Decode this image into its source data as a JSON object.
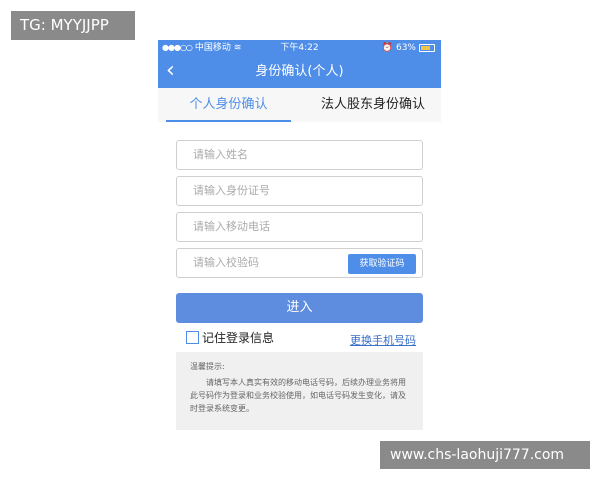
{
  "watermark_top": "TG: MYYJJPP",
  "watermark_bottom": "www.chs-laohuji777.com",
  "status_bar": {
    "carrier": "中国移动",
    "time": "下午4:22",
    "battery": "63%",
    "battery_level": 0.63
  },
  "navbar": {
    "title": "身份确认(个人)"
  },
  "tabs": [
    {
      "label": "个人身份确认",
      "active": true
    },
    {
      "label": "法人股东身份确认",
      "active": false
    }
  ],
  "form": {
    "name_placeholder": "请输入姓名",
    "id_placeholder": "请输入身份证号",
    "phone_placeholder": "请输入移动电话",
    "code_placeholder": "请输入校验码",
    "get_code_label": "获取验证码",
    "submit_label": "进入",
    "remember_label": "记住登录信息",
    "change_phone_label": "更换手机号码"
  },
  "notice": {
    "title": "温馨提示:",
    "body": "请填写本人真实有效的移动电话号码，后续办理业务将用此号码作为登录和业务校验使用，如电话号码发生变化，请及时登录系统变更。"
  },
  "colors": {
    "primary": "#4f8ee8",
    "button": "#5e8ddf",
    "link": "#3a6fc8"
  }
}
